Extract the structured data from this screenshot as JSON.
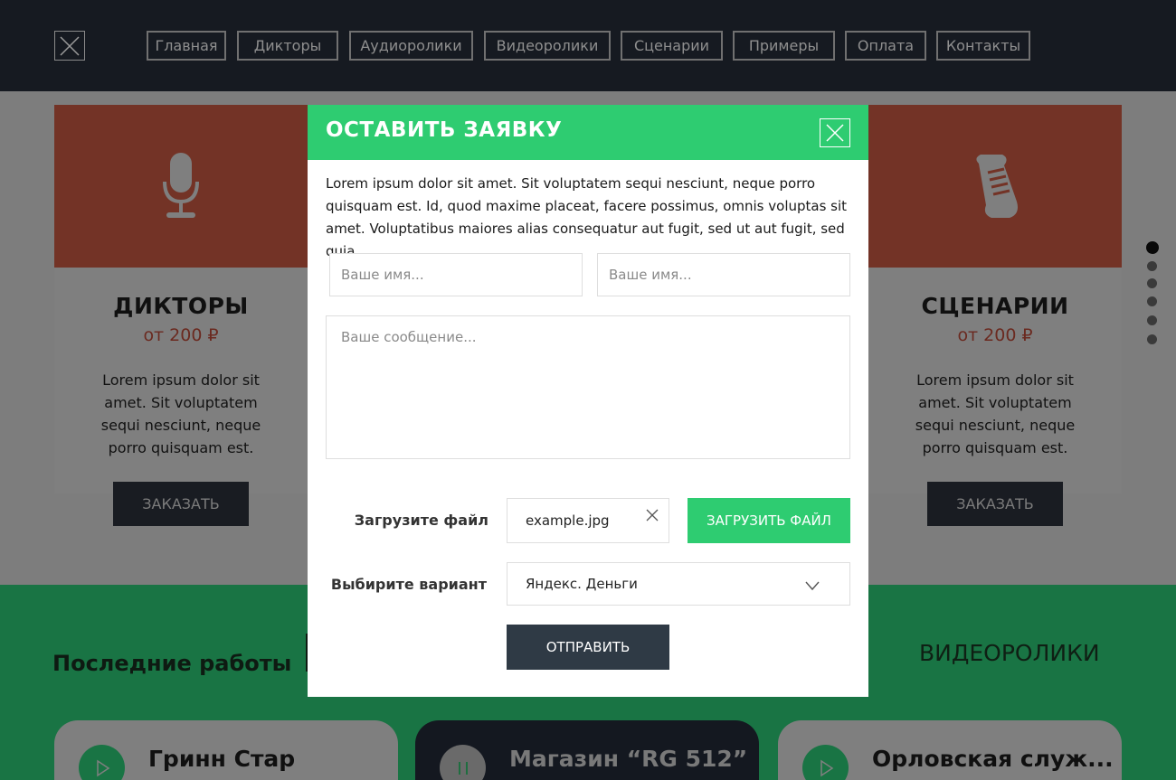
{
  "header": {
    "nav": [
      "Главная",
      "Дикторы",
      "Аудиоролики",
      "Видеоролики",
      "Сценарии",
      "Примеры",
      "Оплата",
      "Контакты"
    ]
  },
  "services": [
    {
      "title": "ДИКТОРЫ",
      "price": "от  200 ₽",
      "text": "Lorem ipsum dolor sit amet. Sit voluptatem sequi nesciunt, neque porro quisquam est.",
      "button": "ЗАКАЗАТЬ",
      "icon": "microphone-icon"
    },
    {
      "title": "СЦЕНАРИИ",
      "price": "от  200 ₽",
      "text": "Lorem ipsum dolor sit amet. Sit voluptatem sequi nesciunt, neque porro quisquam est.",
      "button": "ЗАКАЗАТЬ",
      "icon": "scroll-icon"
    }
  ],
  "works": {
    "title": "Последние работы",
    "tab": "ВИДЕОРОЛИКИ",
    "items": [
      {
        "title": "Гринн Стар",
        "state": "play"
      },
      {
        "title": "Магазин “RG 512”",
        "state": "pause"
      },
      {
        "title": "Орловская служ...",
        "state": "play"
      }
    ]
  },
  "modal": {
    "title": "ОСТАВИТЬ ЗАЯВКУ",
    "description": "Lorem ipsum dolor sit amet. Sit voluptatem sequi nesciunt, neque porro quisquam est. Id, quod maxime placeat, facere possimus, omnis voluptas sit amet. Voluptatibus maiores alias consequatur aut fugit, sed ut aut fugit, sed quia.",
    "name1_placeholder": "Ваше имя...",
    "name2_placeholder": "Ваше имя...",
    "message_placeholder": "Ваше сообщение...",
    "file_label": "Загрузите файл",
    "file_name": "example.jpg",
    "upload_button": "ЗАГРУЗИТЬ ФАЙЛ",
    "variant_label": "Выбирите вариант",
    "variant_value": "Яндекс. Деньги",
    "submit_button": "ОТПРАВИТЬ"
  },
  "colors": {
    "accent": "#2ecc71",
    "header_bg": "#161a21",
    "service_red": "#e74c3c",
    "submit_bg": "#2f3a45"
  },
  "slider": {
    "total": 6,
    "active": 1
  }
}
